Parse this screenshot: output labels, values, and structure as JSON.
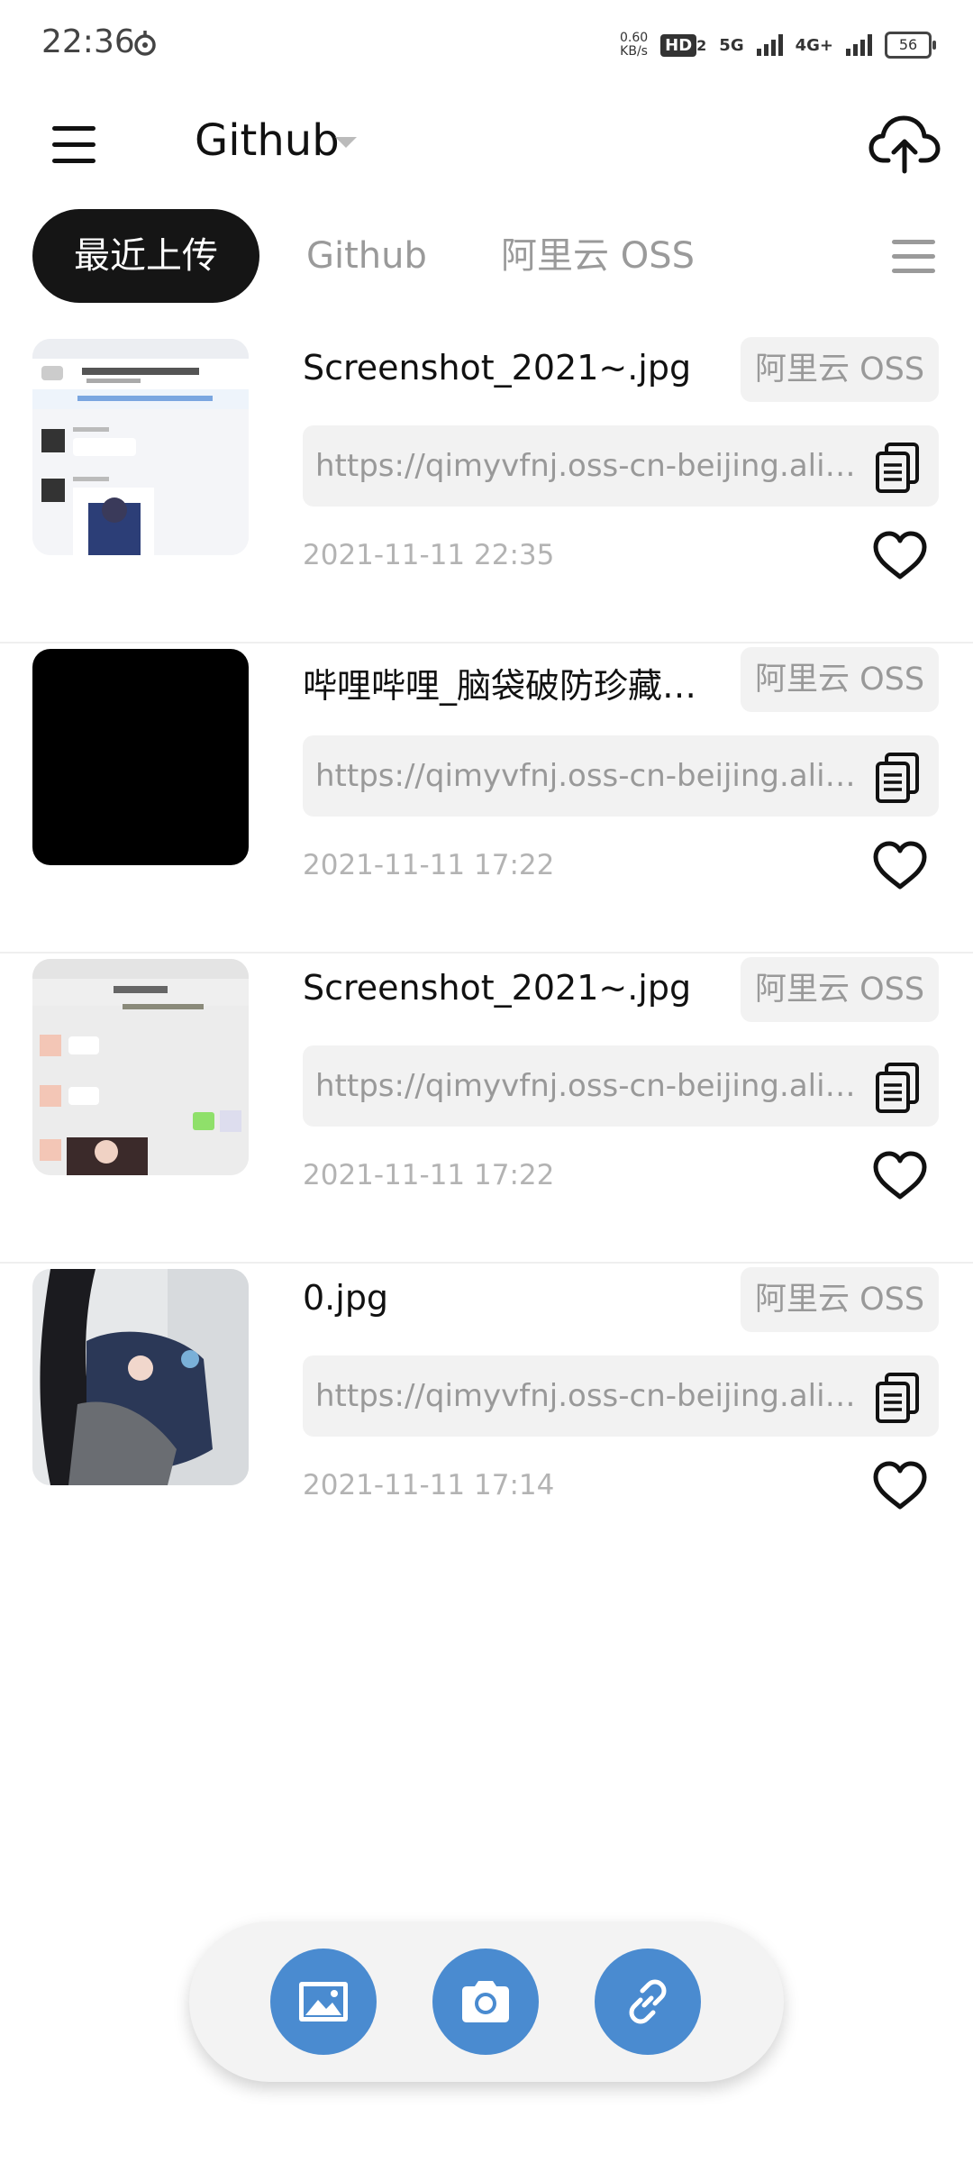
{
  "status_bar": {
    "time": "22:36",
    "speed_value": "0.60",
    "speed_unit": "KB/s",
    "hd_label": "HD",
    "hd_sub": "2",
    "net1": "5G",
    "net2": "4G+",
    "battery": "56"
  },
  "header": {
    "title": "Github"
  },
  "tabs": [
    {
      "label": "最近上传",
      "active": true
    },
    {
      "label": "Github",
      "active": false
    },
    {
      "label": "阿里云 OSS",
      "active": false
    }
  ],
  "items": [
    {
      "title": "Screenshot_2021~.jpg",
      "provider": "阿里云 OSS",
      "url": "https://qimyvfnj.oss-cn-beijing.aliyuncs.com/",
      "date": "2021-11-11  22:35",
      "thumb": "chat-screenshot"
    },
    {
      "title": "哔哩哔哩_脑袋破防珍藏版.jpg",
      "provider": "阿里云 OSS",
      "url": "https://qimyvfnj.oss-cn-beijing.aliyuncs.com/",
      "date": "2021-11-11  17:22",
      "thumb": "black"
    },
    {
      "title": "Screenshot_2021~.jpg",
      "provider": "阿里云 OSS",
      "url": "https://qimyvfnj.oss-cn-beijing.aliyuncs.com/",
      "date": "2021-11-11  17:22",
      "thumb": "chat-screenshot-2"
    },
    {
      "title": "0.jpg",
      "provider": "阿里云 OSS",
      "url": "https://qimyvfnj.oss-cn-beijing.aliyuncs.com/",
      "date": "2021-11-11  17:14",
      "thumb": "photo"
    }
  ],
  "actions": [
    {
      "icon": "image-icon"
    },
    {
      "icon": "camera-icon"
    },
    {
      "icon": "link-icon"
    }
  ],
  "colors": {
    "accent": "#4a8bd0",
    "active_tab_bg": "#151515",
    "muted_text": "#999999"
  }
}
